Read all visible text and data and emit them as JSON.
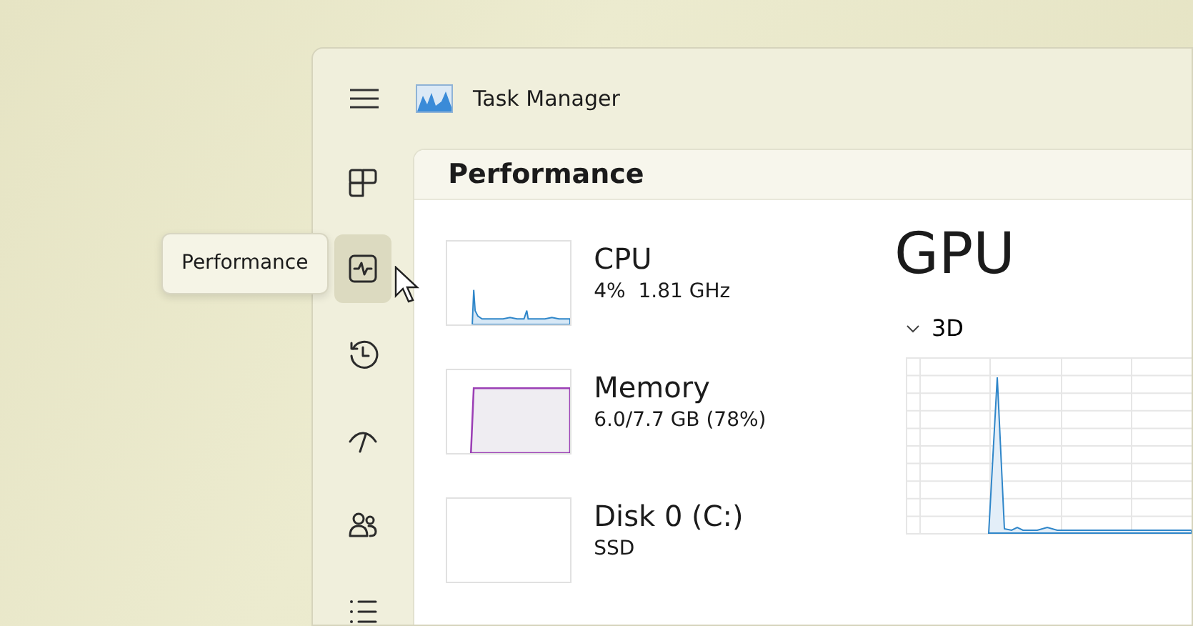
{
  "window": {
    "title": "Task Manager"
  },
  "sidebar": {
    "items": [
      {
        "kind": "processes",
        "selected": false
      },
      {
        "kind": "performance",
        "selected": true
      },
      {
        "kind": "history",
        "selected": false
      },
      {
        "kind": "startup",
        "selected": false
      },
      {
        "kind": "users",
        "selected": false
      },
      {
        "kind": "details",
        "selected": false
      }
    ]
  },
  "tooltip": {
    "text": "Performance"
  },
  "page": {
    "title": "Performance"
  },
  "resources": [
    {
      "kind": "cpu",
      "name": "CPU",
      "detail": "4%  1.81 GHz"
    },
    {
      "kind": "memory",
      "name": "Memory",
      "detail": "6.0/7.7 GB (78%)"
    },
    {
      "kind": "disk",
      "name": "Disk 0 (C:)",
      "detail": "SSD"
    }
  ],
  "detail": {
    "title": "GPU",
    "section": {
      "label": "3D",
      "expanded": true
    }
  }
}
